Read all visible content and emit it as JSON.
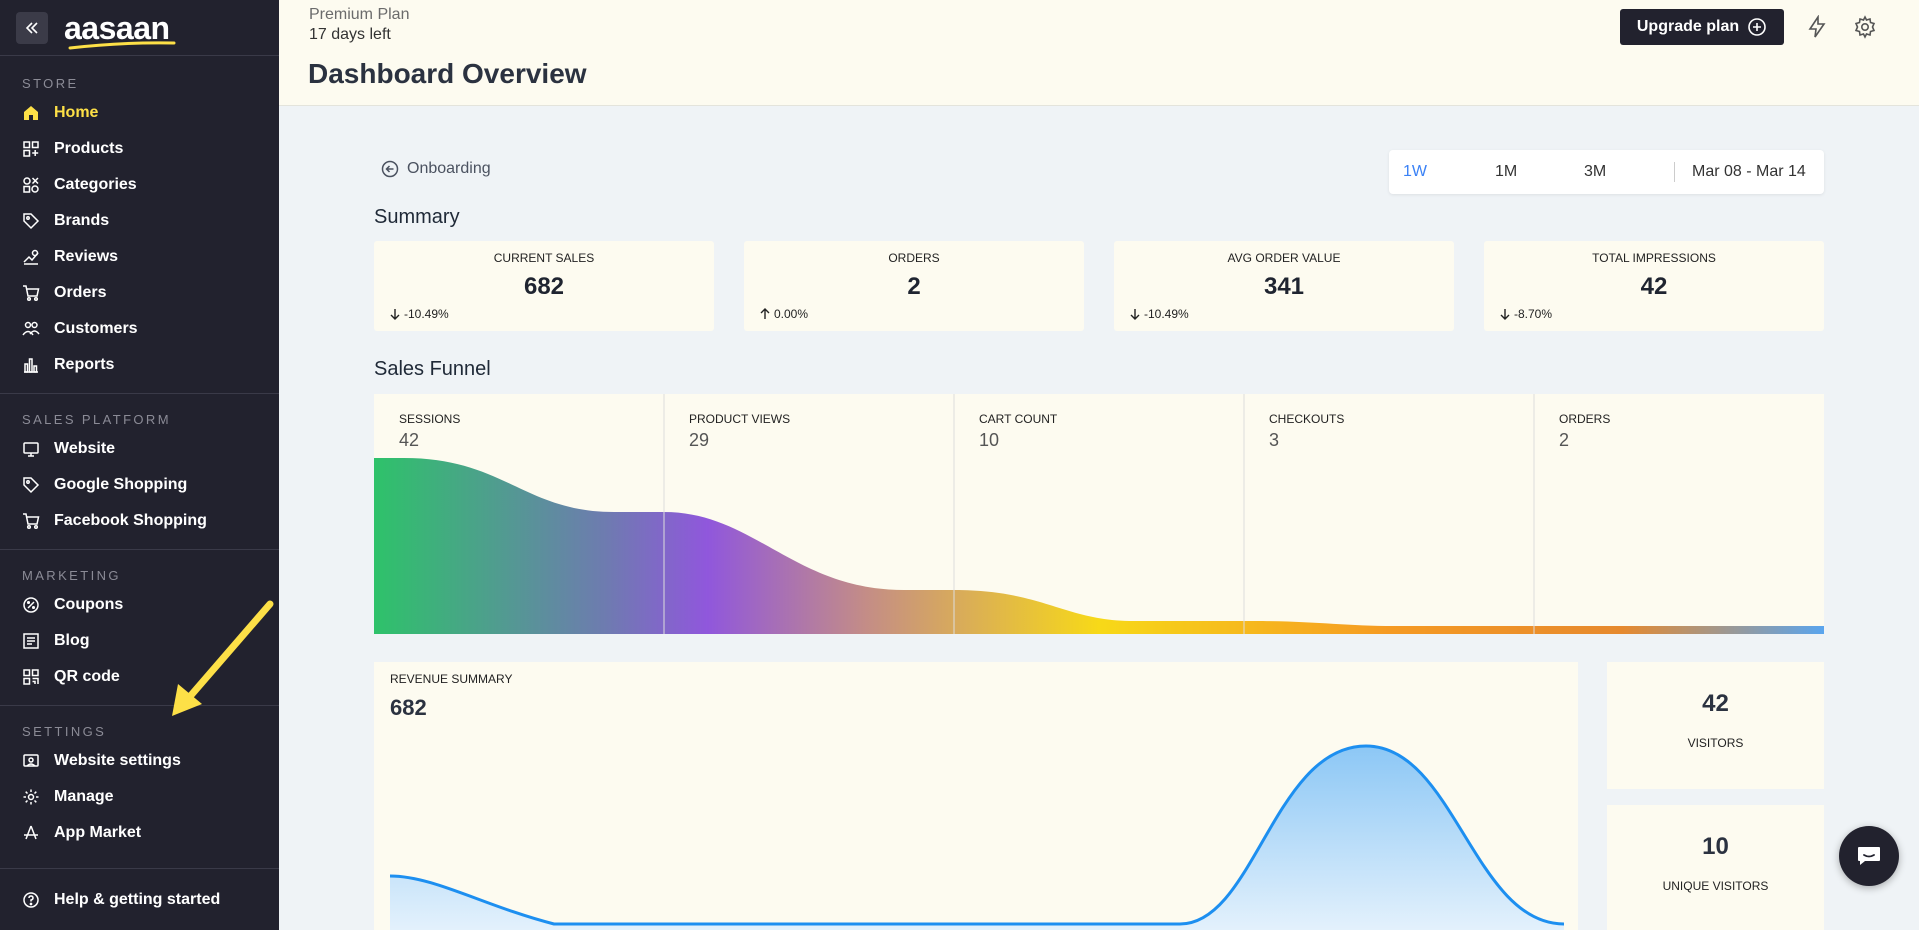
{
  "brand": {
    "name": "aasaan"
  },
  "sidebar": {
    "sections": [
      {
        "title": "STORE",
        "items": [
          {
            "label": "Home",
            "icon": "home-icon",
            "active": true
          },
          {
            "label": "Products",
            "icon": "products-icon"
          },
          {
            "label": "Categories",
            "icon": "categories-icon"
          },
          {
            "label": "Brands",
            "icon": "tag-icon"
          },
          {
            "label": "Reviews",
            "icon": "reviews-icon"
          },
          {
            "label": "Orders",
            "icon": "cart-icon"
          },
          {
            "label": "Customers",
            "icon": "users-icon"
          },
          {
            "label": "Reports",
            "icon": "bar-chart-icon"
          }
        ]
      },
      {
        "title": "SALES PLATFORM",
        "items": [
          {
            "label": "Website",
            "icon": "monitor-icon"
          },
          {
            "label": "Google Shopping",
            "icon": "tag-icon"
          },
          {
            "label": "Facebook Shopping",
            "icon": "cart-icon"
          }
        ]
      },
      {
        "title": "MARKETING",
        "items": [
          {
            "label": "Coupons",
            "icon": "coupon-icon"
          },
          {
            "label": "Blog",
            "icon": "blog-icon"
          },
          {
            "label": "QR code",
            "icon": "qr-icon"
          }
        ]
      },
      {
        "title": "SETTINGS",
        "items": [
          {
            "label": "Website settings",
            "icon": "website-settings-icon"
          },
          {
            "label": "Manage",
            "icon": "gear-icon"
          },
          {
            "label": "App Market",
            "icon": "app-market-icon"
          }
        ]
      }
    ],
    "help_label": "Help & getting started"
  },
  "header": {
    "plan_name": "Premium Plan",
    "plan_days": "17 days left",
    "title": "Dashboard Overview",
    "upgrade_label": "Upgrade plan"
  },
  "onboarding_label": "Onboarding",
  "range": {
    "options": [
      "1W",
      "1M",
      "3M"
    ],
    "selected": "1W",
    "dates": "Mar 08 - Mar 14"
  },
  "summary": {
    "title": "Summary",
    "cards": [
      {
        "label": "CURRENT SALES",
        "value": "682",
        "delta": "-10.49%",
        "direction": "down"
      },
      {
        "label": "ORDERS",
        "value": "2",
        "delta": "0.00%",
        "direction": "up"
      },
      {
        "label": "AVG ORDER VALUE",
        "value": "341",
        "delta": "-10.49%",
        "direction": "down"
      },
      {
        "label": "TOTAL IMPRESSIONS",
        "value": "42",
        "delta": "-8.70%",
        "direction": "down"
      }
    ]
  },
  "funnel": {
    "title": "Sales Funnel",
    "stages": [
      {
        "label": "SESSIONS",
        "value": "42"
      },
      {
        "label": "PRODUCT VIEWS",
        "value": "29"
      },
      {
        "label": "CART COUNT",
        "value": "10"
      },
      {
        "label": "CHECKOUTS",
        "value": "3"
      },
      {
        "label": "ORDERS",
        "value": "2"
      }
    ]
  },
  "chart_data": {
    "type": "area",
    "title": "REVENUE SUMMARY",
    "total": "682",
    "color": "#1d8ff0"
  },
  "stats": [
    {
      "value": "42",
      "label": "VISITORS"
    },
    {
      "value": "10",
      "label": "UNIQUE VISITORS"
    }
  ],
  "colors": {
    "sidebar_bg": "#22222e",
    "active": "#fde047",
    "accent": "#3b82f6",
    "card_bg": "#fdfbf0"
  }
}
